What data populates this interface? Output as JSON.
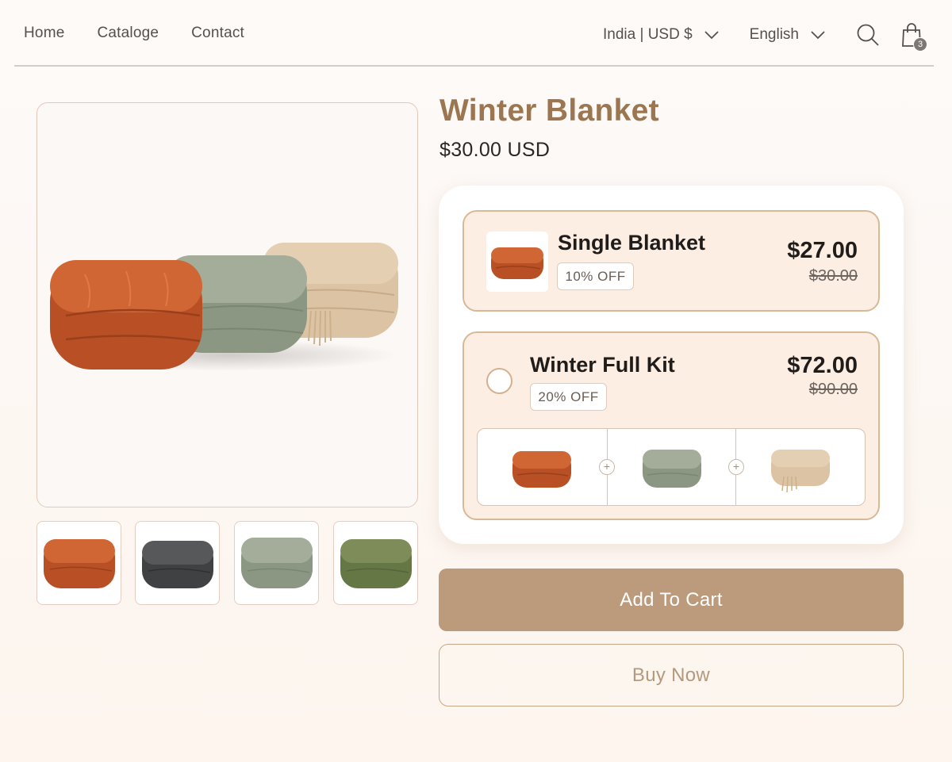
{
  "nav": {
    "items": [
      {
        "label": "Home"
      },
      {
        "label": "Cataloge"
      },
      {
        "label": "Contact"
      }
    ]
  },
  "header": {
    "region": "India | USD $",
    "language": "English",
    "cart_count": "3",
    "icons": [
      "chevron-down-icon",
      "search-icon",
      "shopping-bag-icon"
    ]
  },
  "product": {
    "title": "Winter Blanket",
    "price": "$30.00 USD",
    "thumbnail_colors": [
      "#c2552e",
      "#4a4b4d",
      "#98a08c",
      "#6f8050"
    ]
  },
  "options": [
    {
      "name": "Single Blanket",
      "discount": "10% OFF",
      "price": "$27.00",
      "old_price": "$30.00"
    },
    {
      "name": "Winter Full Kit",
      "discount": "20% OFF",
      "price": "$72.00",
      "old_price": "$90.00",
      "kit_items": [
        "orange",
        "sage",
        "beige"
      ],
      "plus_symbol": "+"
    }
  ],
  "actions": {
    "add_to_cart": "Add To Cart",
    "buy_now": "Buy Now"
  },
  "colors": {
    "title": "#9b7650",
    "accent_button": "#bb9b7b",
    "option_bg": "#fdeee4",
    "option_border": "#d8b896"
  }
}
